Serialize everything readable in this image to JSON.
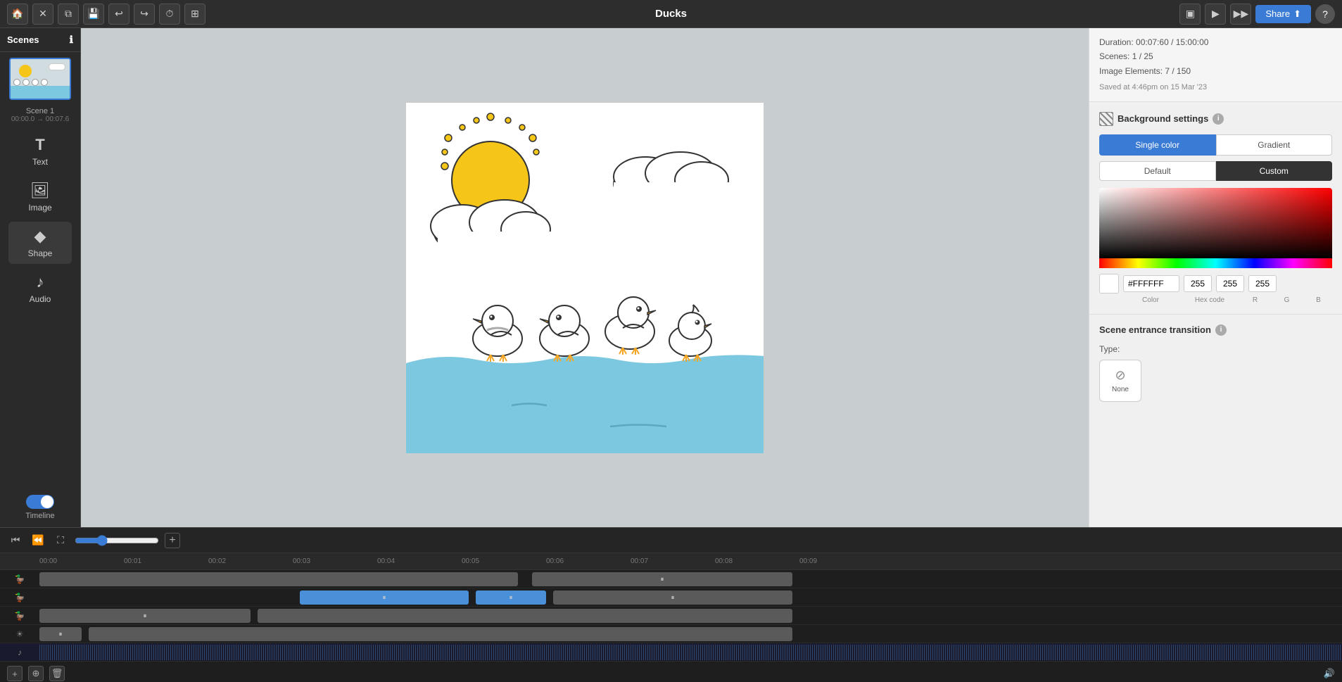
{
  "topbar": {
    "title": "Ducks",
    "share_label": "Share"
  },
  "toolbar": {
    "items": [
      {
        "id": "text",
        "label": "Text",
        "icon": "T"
      },
      {
        "id": "image",
        "label": "Image",
        "icon": "🖼"
      },
      {
        "id": "shape",
        "label": "Shape",
        "icon": "◆"
      },
      {
        "id": "audio",
        "label": "Audio",
        "icon": "♪"
      }
    ]
  },
  "scenes": {
    "title": "Scenes",
    "scene1_label": "Scene 1",
    "scene1_time": "00:00.0 → 00:07.6"
  },
  "timeline_controls": {
    "zoom_value": "",
    "add_label": "+"
  },
  "right_panel": {
    "duration": "Duration: 00:07:60 / 15:00:00",
    "scenes_count": "Scenes: 1 / 25",
    "image_elements": "Image Elements: 7 / 150",
    "saved": "Saved at 4:46pm on 15 Mar '23",
    "bg_settings_title": "Background settings",
    "tab_single": "Single color",
    "tab_gradient": "Gradient",
    "sub_default": "Default",
    "sub_custom": "Custom",
    "hex_value": "#FFFFFF",
    "r_value": "255",
    "g_value": "255",
    "b_value": "255",
    "color_label": "Color",
    "hex_label": "Hex code",
    "r_label": "R",
    "g_label": "G",
    "b_label": "B",
    "transition_title": "Scene entrance transition",
    "type_label": "Type:",
    "none_label": "None"
  },
  "ruler_marks": [
    "00:00",
    "00:01",
    "00:02",
    "00:03",
    "00:04",
    "00:05",
    "00:06",
    "00:07",
    "00:08",
    "00:09"
  ]
}
